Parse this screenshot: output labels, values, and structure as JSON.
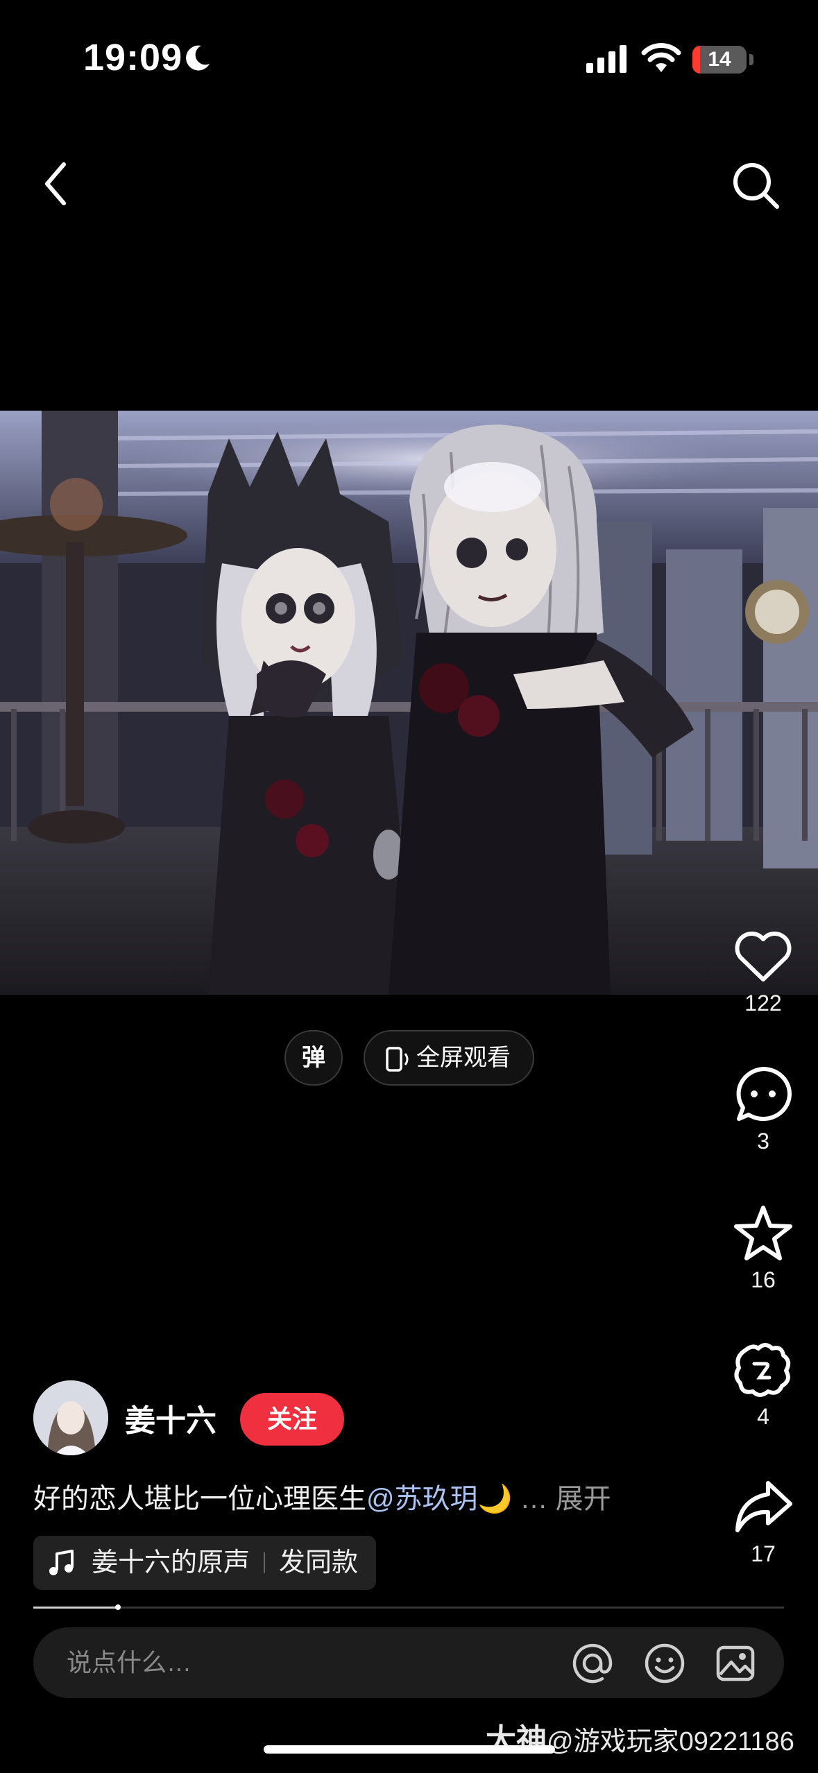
{
  "status_bar": {
    "time": "19:09",
    "battery": "14",
    "icons": [
      "moon-icon",
      "signal-icon",
      "wifi-icon",
      "battery-icon"
    ],
    "battery_color": "#ff3b30"
  },
  "nav": {
    "icons": [
      "back-chevron-icon",
      "search-icon"
    ]
  },
  "video_controls": {
    "danmaku_label": "弹",
    "fullscreen_label": "全屏观看"
  },
  "actions": {
    "likes": "122",
    "comments": "3",
    "favorites": "16",
    "gifts": "4",
    "shares": "17"
  },
  "author": {
    "name": "姜十六",
    "follow_label": "关注"
  },
  "caption": {
    "text": "好的恋人堪比一位心理医生",
    "mention": "@苏玖玥",
    "emoji": "🌙",
    "more": "… 展开"
  },
  "music": {
    "title": "姜十六的原声",
    "action": "发同款"
  },
  "progress": {
    "played_fraction": 0.11
  },
  "comment_bar": {
    "placeholder": "说点什么…",
    "icons": [
      "mention-icon",
      "emoji-icon",
      "image-icon"
    ]
  },
  "watermark": {
    "brand": "大神",
    "handle": "@游戏玩家09221186"
  },
  "colors": {
    "accent_red": "#f0303e",
    "mention_blue": "#a9c4f3",
    "background": "#000000"
  }
}
